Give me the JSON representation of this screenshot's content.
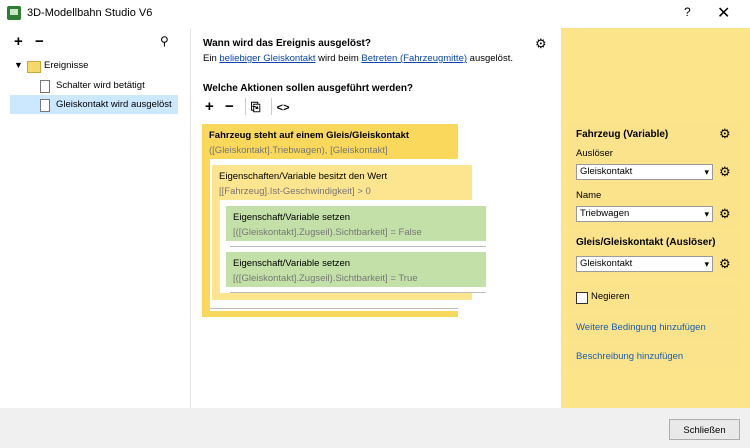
{
  "window": {
    "title": "3D-Modellbahn Studio V6",
    "help": "?",
    "close": "✕"
  },
  "tree": {
    "add": "+",
    "remove": "−",
    "search": "⚲",
    "root": "Ereignisse",
    "items": [
      "Schalter wird betätigt",
      "Gleiskontakt wird ausgelöst"
    ]
  },
  "trigger": {
    "heading": "Wann wird das Ereignis ausgelöst?",
    "line_pre": "Ein",
    "link1": "beliebiger Gleiskontakt",
    "line_mid": "wird beim",
    "link2": "Betreten (Fahrzeugmitte)",
    "line_post": "ausgelöst."
  },
  "actions": {
    "heading": "Welche Aktionen sollen ausgeführt werden?",
    "tools": [
      "+",
      "−",
      "⎘",
      "<>"
    ],
    "blocks": [
      {
        "title": "Fahrzeug steht auf einem Gleis/Gleiskontakt",
        "sub": "([Gleiskontakt].Triebwagen), [Gleiskontakt]"
      },
      {
        "title": "Eigenschaften/Variable besitzt den Wert",
        "sub": "[[Fahrzeug].Ist-Geschwindigkeit] > 0"
      },
      {
        "title": "Eigenschaft/Variable setzen",
        "sub": "[([Gleiskontakt].Zugseil).Sichtbarkeit] = False"
      },
      {
        "title": "Eigenschaft/Variable setzen",
        "sub": "[([Gleiskontakt].Zugseil).Sichtbarkeit] = True"
      }
    ]
  },
  "panel": {
    "vehicle_title": "Fahrzeug (Variable)",
    "trigger_label": "Auslöser",
    "trigger_value": "Gleiskontakt",
    "name_label": "Name",
    "name_value": "Triebwagen",
    "contact_title": "Gleis/Gleiskontakt (Auslöser)",
    "contact_value": "Gleiskontakt",
    "negate_label": "Negieren",
    "add_condition": "Weitere Bedingung hinzufügen",
    "add_description": "Beschreibung hinzufügen"
  },
  "footer": {
    "close_label": "Schließen"
  }
}
